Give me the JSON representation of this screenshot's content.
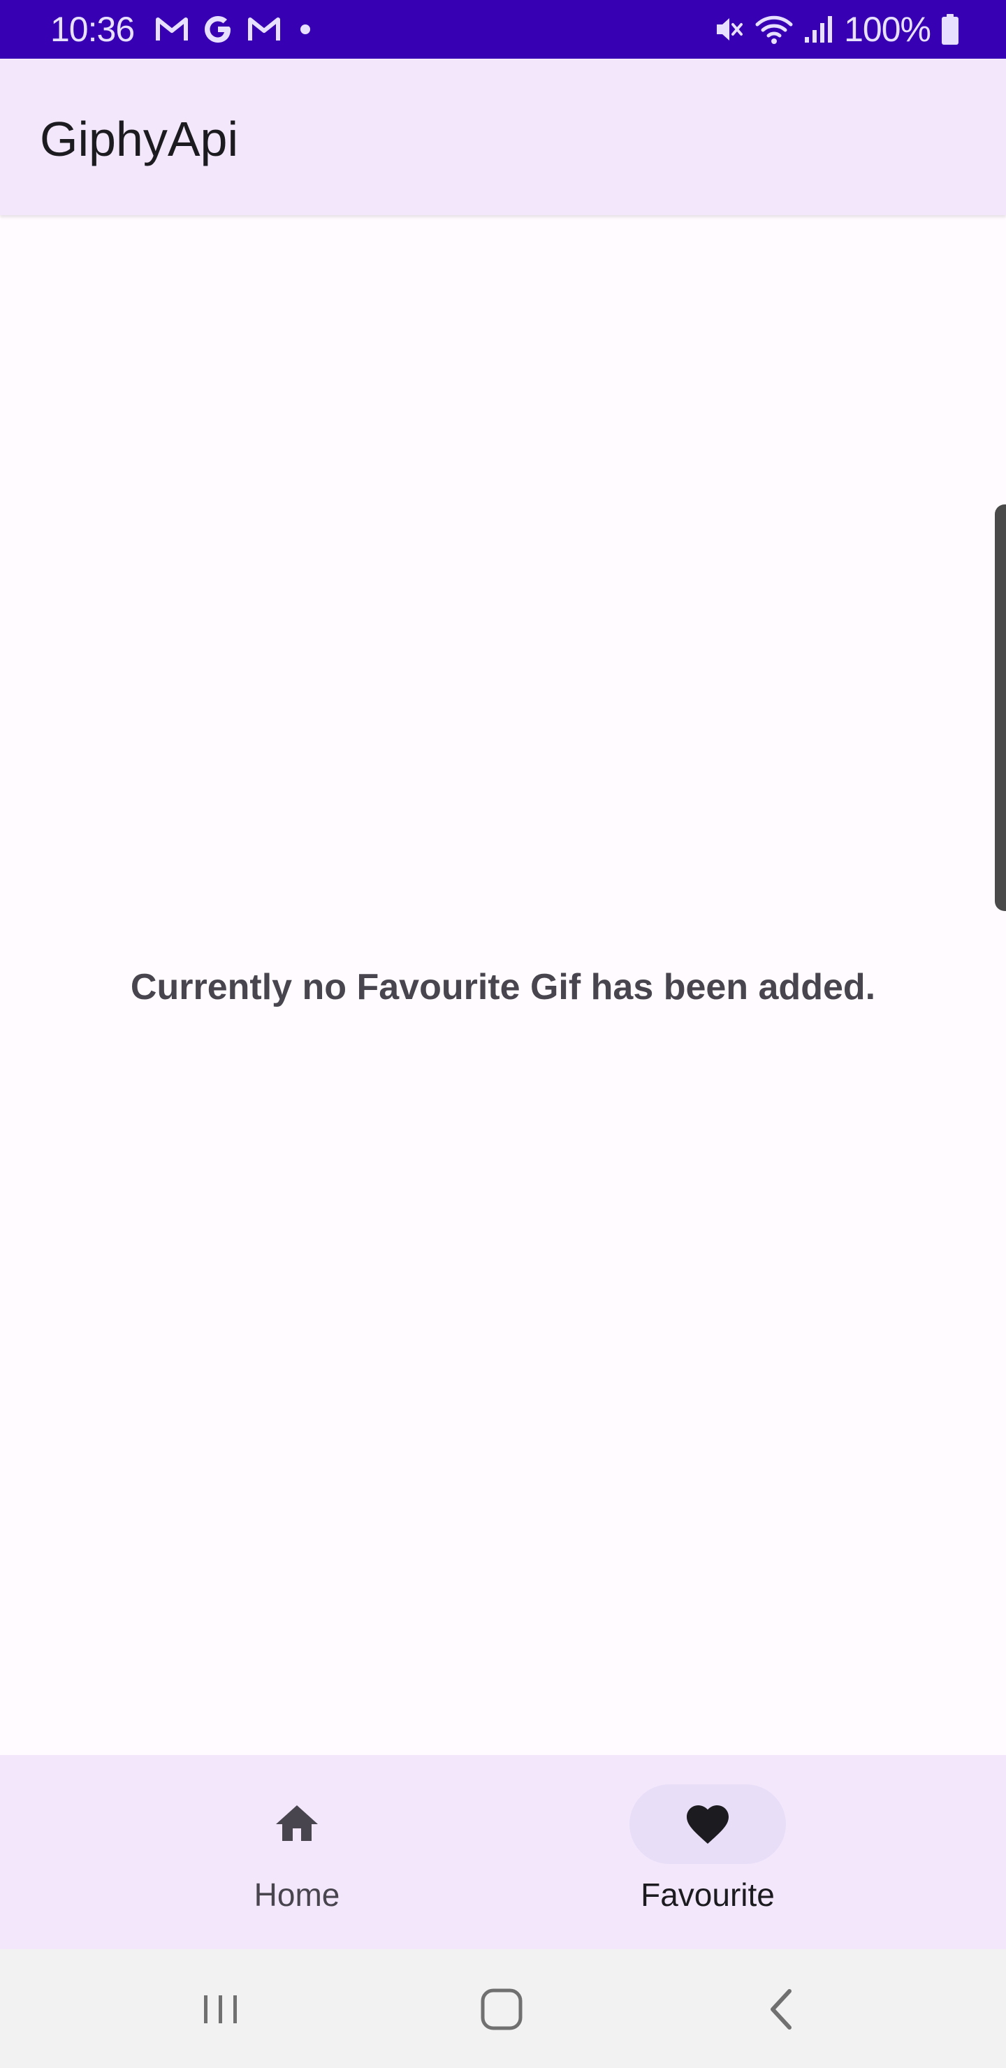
{
  "status_bar": {
    "time": "10:36",
    "battery": "100%",
    "background": "#3700b3",
    "left_icons": [
      "gmail-icon",
      "google-icon",
      "gmail-icon",
      "notification-dot-icon"
    ],
    "right_icons": [
      "mute-icon",
      "wifi-icon",
      "signal-icon",
      "battery-icon"
    ]
  },
  "app_bar": {
    "title": "GiphyApi",
    "background": "#f3e7fb"
  },
  "main": {
    "empty_message": "Currently no Favourite Gif has been added."
  },
  "bottom_nav": {
    "items": [
      {
        "label": "Home",
        "icon": "home-icon",
        "selected": false
      },
      {
        "label": "Favourite",
        "icon": "heart-icon",
        "selected": true
      }
    ],
    "indicator_color": "#e8def8"
  },
  "system_nav": {
    "buttons": [
      "recents-icon",
      "home-circle-icon",
      "back-icon"
    ]
  }
}
